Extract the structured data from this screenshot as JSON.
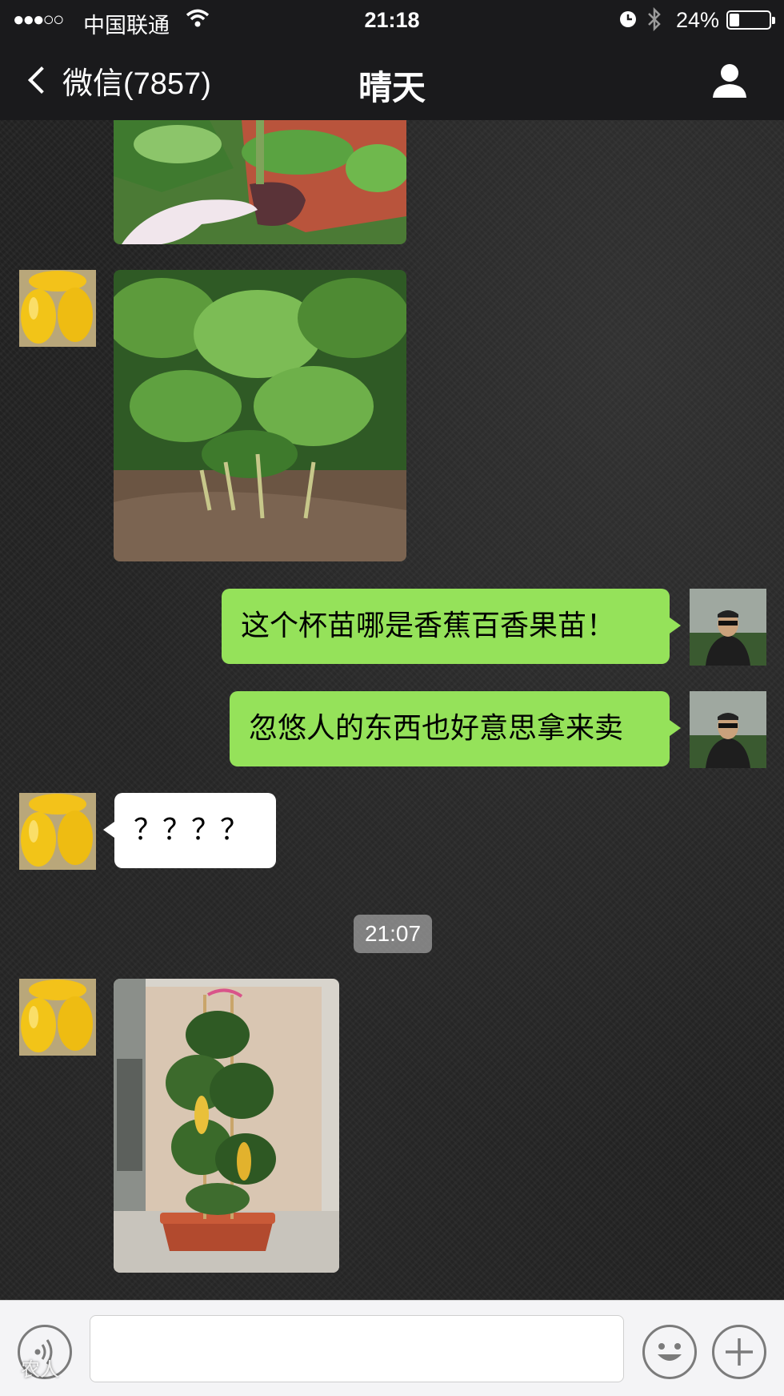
{
  "status_bar": {
    "signal": "●●●○○",
    "carrier": "中国联通",
    "time": "21:18",
    "battery_pct": "24%",
    "battery_level": 0.24,
    "icons": [
      "wifi-icon",
      "alarm-icon",
      "bluetooth-icon",
      "battery-icon"
    ]
  },
  "nav": {
    "back_label": "微信(7857)",
    "title": "晴天",
    "right_icon": "profile-icon"
  },
  "messages": [
    {
      "side": "left",
      "type": "image",
      "desc_icon": "plant-image"
    },
    {
      "side": "left",
      "type": "image",
      "desc_icon": "plant-image"
    },
    {
      "side": "right",
      "type": "text",
      "text": "这个杯苗哪是香蕉百香果苗！"
    },
    {
      "side": "right",
      "type": "text",
      "text": "忽悠人的东西也好意思拿来卖"
    },
    {
      "side": "left",
      "type": "text",
      "text": "？？？？"
    },
    {
      "side": "left",
      "type": "image",
      "desc_icon": "potted-plant-image"
    }
  ],
  "timestamp": "21:07",
  "input_bar": {
    "value": "",
    "placeholder": ""
  },
  "watermark": "农人",
  "colors": {
    "bar_bg": "#1a1a1c",
    "my_bubble": "#95e25a",
    "their_bubble": "#ffffff",
    "input_bg": "#f4f4f6"
  }
}
